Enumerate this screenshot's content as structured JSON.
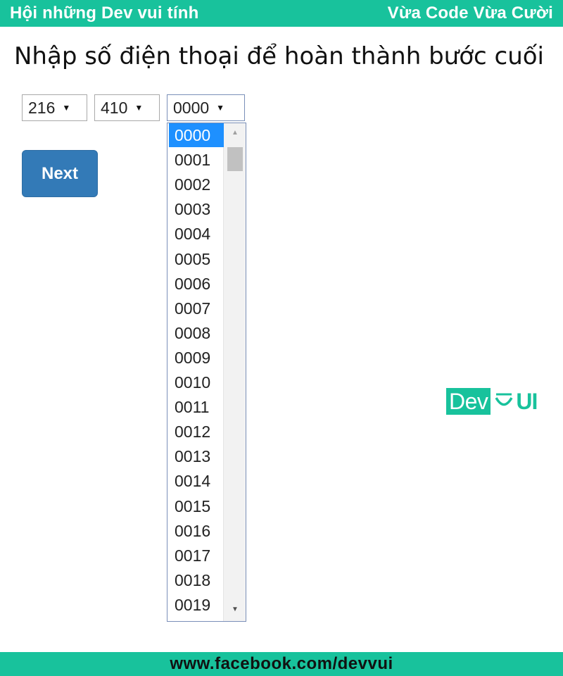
{
  "banner": {
    "left": "Hội những Dev vui tính",
    "right": "Vừa Code Vừa Cười"
  },
  "heading": "Nhập số điện thoại để hoàn thành bước cuối",
  "selects": {
    "first": "216",
    "second": "410",
    "third": "0000"
  },
  "dropdown_options": [
    "0000",
    "0001",
    "0002",
    "0003",
    "0004",
    "0005",
    "0006",
    "0007",
    "0008",
    "0009",
    "0010",
    "0011",
    "0012",
    "0013",
    "0014",
    "0015",
    "0016",
    "0017",
    "0018",
    "0019"
  ],
  "selected_index": 0,
  "next_label": "Next",
  "logo": {
    "box": "Dev",
    "tail": "UI"
  },
  "footer": "www.facebook.com/devvui",
  "colors": {
    "brand": "#18c29c",
    "button": "#337ab7",
    "highlight": "#1e90ff"
  },
  "icons": {
    "select_arrow": "caret-down-icon",
    "scroll_up": "scroll-up-icon",
    "scroll_down": "scroll-down-icon"
  }
}
